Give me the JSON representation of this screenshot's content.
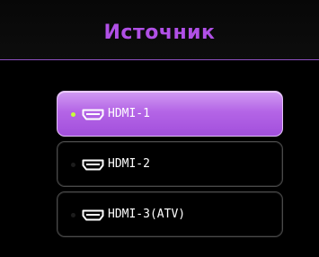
{
  "header": {
    "title": "Источник"
  },
  "sources": {
    "selected_index": 0,
    "items": [
      {
        "label": "HDMI-1",
        "icon": "hdmi-connector-icon"
      },
      {
        "label": "HDMI-2",
        "icon": "hdmi-connector-icon"
      },
      {
        "label": "HDMI-3(ATV)",
        "icon": "hdmi-connector-icon"
      }
    ]
  },
  "colors": {
    "title": "#b050e6",
    "selected_background": "#b465e6",
    "selected_indicator": "#c8ff3c",
    "divider": "#8e50c0"
  }
}
